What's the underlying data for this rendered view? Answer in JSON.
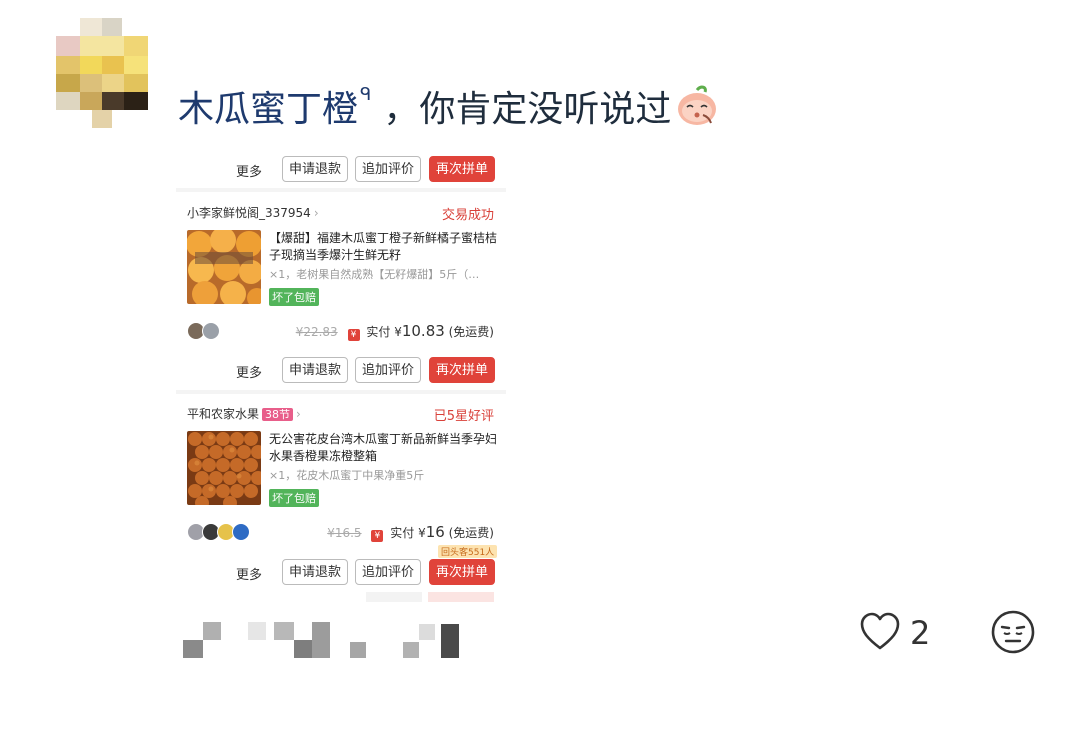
{
  "post": {
    "title_highlight": "木瓜蜜丁橙",
    "search_glyph": "ᑫ",
    "title_rest": "，你肯定没听说过"
  },
  "screenshot": {
    "top_buttons": {
      "more": "更多",
      "refund": "申请退款",
      "review": "追加评价",
      "regroup": "再次拼单"
    },
    "orders": [
      {
        "shop": "小李家鲜悦阁_337954",
        "shop_tag": "",
        "status": "交易成功",
        "title": "【爆甜】福建木瓜蜜丁橙子新鲜橘子蜜桔桔子现摘当季爆汁生鲜无籽",
        "spec": "×1，老树果自然成熟【无籽爆甜】5斤（…",
        "badge": "坏了包赔",
        "orig_price": "¥22.83",
        "paid_label": "实付",
        "paid_currency": "¥",
        "paid_amount": "10.83",
        "shipping": "(免运费)",
        "buttons": {
          "more": "更多",
          "refund": "申请退款",
          "review": "追加评价",
          "regroup": "再次拼单"
        }
      },
      {
        "shop": "平和农家水果",
        "shop_tag": "38节",
        "status": "已5星好评",
        "title": "无公害花皮台湾木瓜蜜丁新品新鲜当季孕妇水果香橙果冻橙整箱",
        "spec": "×1，花皮木瓜蜜丁中果净重5斤",
        "badge": "坏了包赔",
        "orig_price": "¥16.5",
        "paid_label": "实付",
        "paid_currency": "¥",
        "paid_amount": "16",
        "shipping": "(免运费)",
        "repeat_badge": "回头客551人",
        "buttons": {
          "more": "更多",
          "refund": "申请退款",
          "review": "追加评价",
          "regroup": "再次拼单"
        }
      }
    ]
  },
  "footer": {
    "like_count": "2",
    "heart_icon": "heart-outline-icon",
    "face_icon": "expressionless-face-icon"
  },
  "colors": {
    "accent_red": "#e0433a",
    "badge_green": "#52b45a",
    "title_blue": "#1e3a6e"
  }
}
